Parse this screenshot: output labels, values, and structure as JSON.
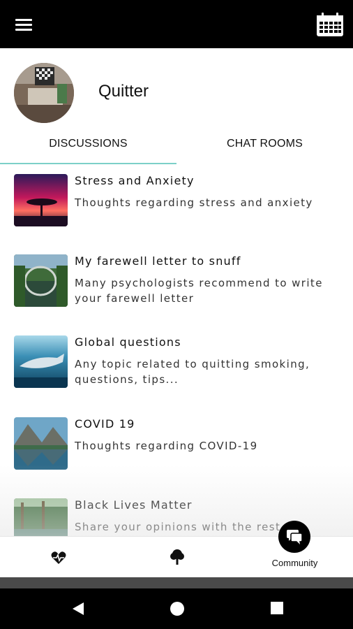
{
  "header": {
    "menu_icon": "hamburger-menu-icon",
    "calendar_icon": "calendar-icon"
  },
  "profile": {
    "name": "Quitter",
    "avatar": "avatar-photo"
  },
  "tabs": [
    {
      "label": "DISCUSSIONS",
      "active": true
    },
    {
      "label": "CHAT ROOMS",
      "active": false
    }
  ],
  "accent_color": "#7cd0c8",
  "discussions": [
    {
      "title": "Stress and Anxiety",
      "description": "Thoughts regarding stress and anxiety",
      "image": "sunset-tree"
    },
    {
      "title": "My farewell letter to snuff",
      "description": "Many psychologists recommend to write your farewell letter",
      "image": "bridge-reflection"
    },
    {
      "title": "Global questions",
      "description": "Any topic related to quitting smoking, questions, tips...",
      "image": "whale-underwater"
    },
    {
      "title": "COVID 19",
      "description": "Thoughts regarding COVID-19",
      "image": "mountain-lake"
    },
    {
      "title": "Black Lives Matter",
      "description": "Share your opinions with the rest of",
      "image": "forest-water"
    }
  ],
  "bottom_nav": {
    "items": [
      {
        "icon": "heartbeat-icon"
      },
      {
        "icon": "tree-icon"
      },
      {
        "icon": "chat-bubbles-icon",
        "label": "Community",
        "active": true
      }
    ]
  },
  "system_nav": [
    "back-icon",
    "home-icon",
    "recents-icon"
  ]
}
